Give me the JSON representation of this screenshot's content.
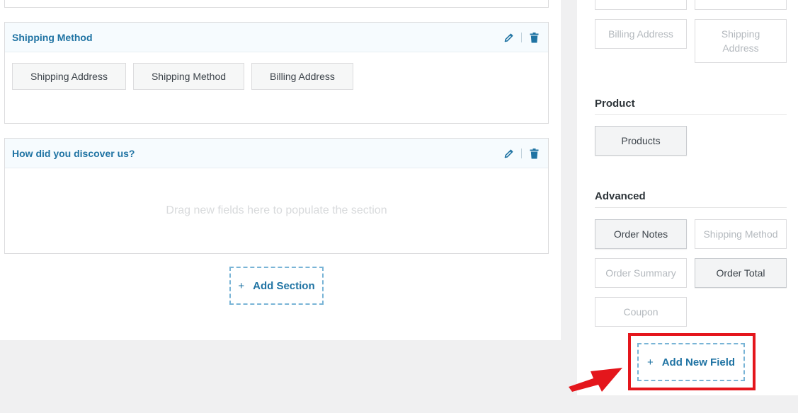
{
  "sections": [
    {
      "title": "Shipping Method",
      "fields": [
        "Shipping Address",
        "Shipping Method",
        "Billing Address"
      ]
    },
    {
      "title": "How did you discover us?",
      "empty_hint": "Drag new fields here to populate the section"
    }
  ],
  "add_section": {
    "plus": "+",
    "label": "Add Section"
  },
  "sidebar": {
    "address_fields": [
      {
        "label": "Billing Address",
        "enabled": false
      },
      {
        "label": "Shipping Address",
        "enabled": false
      }
    ],
    "product": {
      "title": "Product",
      "fields": [
        {
          "label": "Products",
          "enabled": true
        }
      ]
    },
    "advanced": {
      "title": "Advanced",
      "fields": [
        {
          "label": "Order Notes",
          "enabled": true
        },
        {
          "label": "Shipping Method",
          "enabled": false
        },
        {
          "label": "Order Summary",
          "enabled": false
        },
        {
          "label": "Order Total",
          "enabled": true
        },
        {
          "label": "Coupon",
          "enabled": false
        }
      ]
    },
    "add_field": {
      "plus": "+",
      "label": "Add New Field"
    }
  },
  "icons": {
    "edit": "pencil-icon",
    "delete": "trash-icon"
  },
  "colors": {
    "accent": "#1f73a3",
    "highlight": "#e4161c",
    "dashed_border": "#79b4d6"
  }
}
